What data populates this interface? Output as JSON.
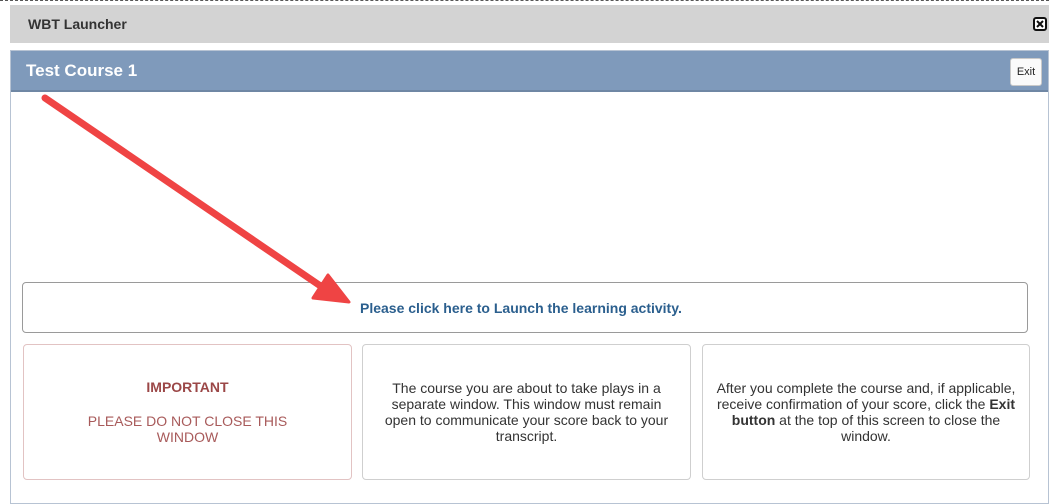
{
  "launcher": {
    "title": "WBT Launcher"
  },
  "course": {
    "title": "Test Course 1",
    "exit_label": "Exit"
  },
  "launch": {
    "link_text": "Please click here to Launch the learning activity."
  },
  "cards": {
    "important": {
      "heading": "IMPORTANT",
      "body": "PLEASE DO NOT CLOSE THIS WINDOW"
    },
    "window_note": "The course you are about to take plays in a separate window. This window must remain open to communicate your score back to your transcript.",
    "exit_note": {
      "before": "After you complete the course and, if applicable, receive confirmation of your score, click the ",
      "bold": "Exit button",
      "after": " at the top of this screen to close the window."
    }
  },
  "colors": {
    "header_bg": "#7f9abb",
    "link": "#2b5f8e",
    "arrow": "#ef4444",
    "important_text": "#a05050"
  },
  "icons": {
    "close": "close-icon",
    "annotation": "red-arrow-icon"
  }
}
